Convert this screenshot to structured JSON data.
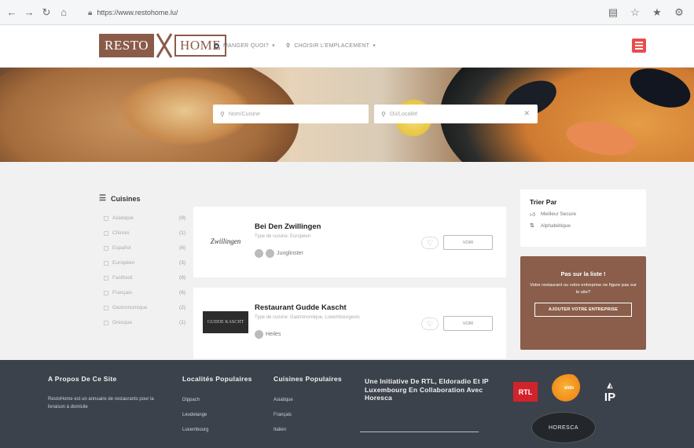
{
  "browser": {
    "url": "https://www.restohome.lu/"
  },
  "header": {
    "logo_left": "RESTO",
    "logo_right": "HOME",
    "nav": [
      {
        "label": "MANGER QUOI?"
      },
      {
        "label": "CHOISIR L'EMPLACEMENT"
      }
    ]
  },
  "search": {
    "cuisine_placeholder": "Nom/Cuisine",
    "location_placeholder": "Où/Localité"
  },
  "filters": {
    "title": "Cuisines",
    "items": [
      {
        "label": "Asiatique",
        "count": "(9)"
      },
      {
        "label": "Chinois",
        "count": "(1)"
      },
      {
        "label": "Español",
        "count": "(6)"
      },
      {
        "label": "Européen",
        "count": "(3)"
      },
      {
        "label": "Fastfood",
        "count": "(8)"
      },
      {
        "label": "Français",
        "count": "(6)"
      },
      {
        "label": "Gastronomique",
        "count": "(2)"
      },
      {
        "label": "Grecque",
        "count": "(1)"
      }
    ]
  },
  "restaurants": [
    {
      "name": "Bei Den Zwillingen",
      "type": "Type de cuisine: Européen",
      "locality": "Junglinster",
      "logo_text": "Zwillingen",
      "voir_label": "VOIR"
    },
    {
      "name": "Restaurant Gudde Kascht",
      "type": "Type de cuisine: Gastronomique, Luxembourgeois",
      "locality": "Heiles",
      "logo_text": "GUDDE KASCHT",
      "voir_label": "VOIR"
    }
  ],
  "sort": {
    "title": "Trier Par",
    "options": [
      {
        "label": "Meilleur Secure",
        "icon": "thumb-icon"
      },
      {
        "label": "Alphabétique",
        "icon": "sort-az-icon"
      }
    ]
  },
  "promo": {
    "title": "Pas sur la liste !",
    "text": "Votre restaurant ou votre entreprise ne figure pas sur le site?",
    "button": "AJOUTER VOTRE ENTREPRISE"
  },
  "footer": {
    "about_title": "A Propos De Ce Site",
    "about_text": "RestoHome est un annuaire de restaurants pour la livraison à domicile",
    "localities_title": "Localités Populaires",
    "localities": [
      "Dippach",
      "Leudelange",
      "Luxembourg"
    ],
    "cuisines_title": "Cuisines Populaires",
    "cuisines": [
      "Asiatique",
      "Français",
      "Italien"
    ],
    "initiative": "Une Initiative De RTL, Eldoradio Et IP Luxembourg En Collaboration Avec Horesca",
    "rtl_label": "RTL",
    "eldo_label": "eldo",
    "ip_label": "IP",
    "horesca_label": "HORESCA"
  }
}
